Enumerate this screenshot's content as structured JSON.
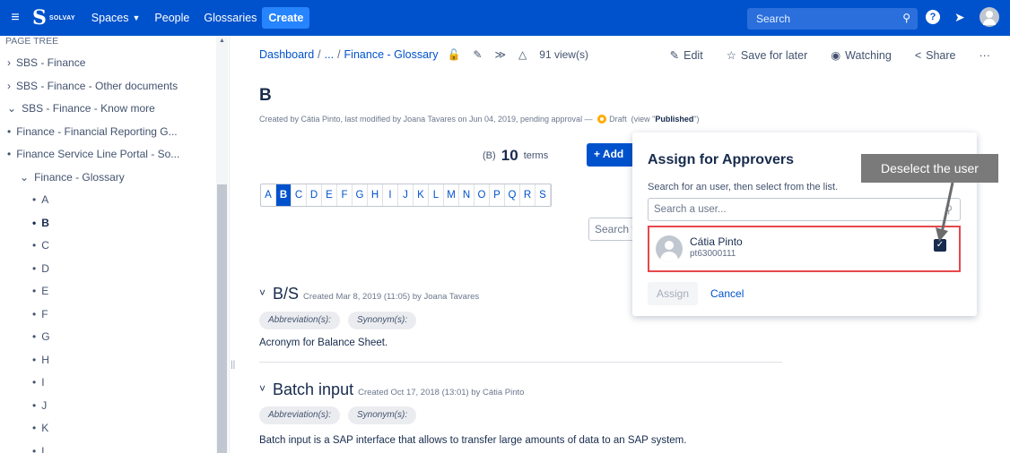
{
  "topnav": {
    "brand": "SOLVAY",
    "spaces": "Spaces",
    "people": "People",
    "glossaries": "Glossaries",
    "create": "Create",
    "search_placeholder": "Search"
  },
  "sidebar": {
    "title": "PAGE TREE",
    "items": [
      {
        "label": "SBS - Finance",
        "prefix": "›"
      },
      {
        "label": "SBS - Finance - Other documents",
        "prefix": "›"
      },
      {
        "label": "SBS - Finance - Know more",
        "prefix": "⌄"
      },
      {
        "label": "Finance - Financial Reporting G...",
        "prefix": "•"
      },
      {
        "label": "Finance Service Line Portal - So...",
        "prefix": "•"
      },
      {
        "label": "Finance - Glossary",
        "prefix": "⌄"
      },
      {
        "label": "A",
        "prefix": "•"
      },
      {
        "label": "B",
        "prefix": "•"
      },
      {
        "label": "C",
        "prefix": "•"
      },
      {
        "label": "D",
        "prefix": "•"
      },
      {
        "label": "E",
        "prefix": "•"
      },
      {
        "label": "F",
        "prefix": "•"
      },
      {
        "label": "G",
        "prefix": "•"
      },
      {
        "label": "H",
        "prefix": "•"
      },
      {
        "label": "I",
        "prefix": "•"
      },
      {
        "label": "J",
        "prefix": "•"
      },
      {
        "label": "K",
        "prefix": "•"
      },
      {
        "label": "L",
        "prefix": "•"
      }
    ]
  },
  "breadcrumb": {
    "dashboard": "Dashboard",
    "ellipsis": "...",
    "glossary": "Finance - Glossary",
    "views": "91 view(s)"
  },
  "actions": {
    "edit": "Edit",
    "save_for_later": "Save for later",
    "watching": "Watching",
    "share": "Share",
    "more": "···"
  },
  "page": {
    "title": "B",
    "byline_pre": "Created by Cátia Pinto, last modified by Joana Tavares on Jun 04, 2019, pending approval —",
    "draft": "Draft",
    "view_pre": "(view \"",
    "published": "Published",
    "view_post": "\")",
    "terms_prefix": "(B)",
    "terms_count": "10",
    "terms_suffix": "terms",
    "add_button": "+ Add",
    "letters": [
      "A",
      "B",
      "C",
      "D",
      "E",
      "F",
      "G",
      "H",
      "I",
      "J",
      "K",
      "L",
      "M",
      "N",
      "O",
      "P",
      "Q",
      "R",
      "S"
    ],
    "active_letter": "B",
    "glossary_search": "Search t"
  },
  "entries": [
    {
      "title": "B/S",
      "meta": "Created Mar 8, 2019 (11:05) by Joana Tavares",
      "abbr": "Abbreviation(s):",
      "syn": "Synonym(s):",
      "desc": "Acronym for Balance Sheet."
    },
    {
      "title": "Batch input",
      "meta": "Created Oct 17, 2018 (13:01) by Cátia Pinto",
      "abbr": "Abbreviation(s):",
      "syn": "Synonym(s):",
      "desc": "Batch input is a SAP interface that allows to transfer large amounts of data to an SAP system."
    }
  ],
  "dialog": {
    "title": "Assign for Approvers",
    "help": "Search for an user, then select from the list.",
    "search_placeholder": "Search a user...",
    "user_name": "Cátia Pinto",
    "user_id": "pt63000111",
    "checked": true,
    "assign": "Assign",
    "cancel": "Cancel"
  },
  "callout": {
    "text": "Deselect the user"
  },
  "colors": {
    "brand": "#0052cc",
    "highlight": "#e5484d",
    "draft": "#ffab00",
    "callout": "#7a7a7a"
  }
}
